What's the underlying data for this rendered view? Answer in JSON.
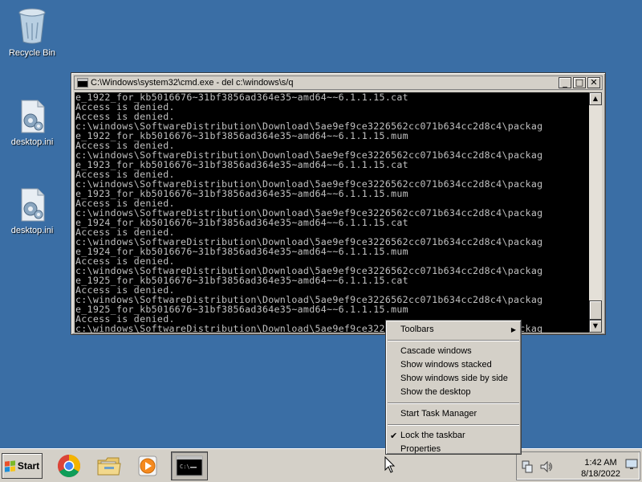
{
  "desktop": {
    "icons": [
      {
        "label": "Recycle Bin",
        "icon": "recycle-bin-icon"
      },
      {
        "label": "desktop.ini",
        "icon": "settings-file-icon"
      },
      {
        "label": "desktop.ini",
        "icon": "settings-file-icon"
      }
    ]
  },
  "cmd": {
    "title": "C:\\Windows\\system32\\cmd.exe - del  c:\\windows\\s/q",
    "minimize_glyph": "_",
    "maximize_glyph": "□",
    "close_glyph": "✕",
    "scroll_up_glyph": "▲",
    "scroll_down_glyph": "▼",
    "lines": [
      "e_1922_for_kb5016676~31bf3856ad364e35~amd64~~6.1.1.15.cat",
      "Access is denied.",
      "Access is denied.",
      "c:\\windows\\SoftwareDistribution\\Download\\5ae9ef9ce3226562cc071b634cc2d8c4\\packag",
      "e_1922_for_kb5016676~31bf3856ad364e35~amd64~~6.1.1.15.mum",
      "Access is denied.",
      "c:\\windows\\SoftwareDistribution\\Download\\5ae9ef9ce3226562cc071b634cc2d8c4\\packag",
      "e_1923_for_kb5016676~31bf3856ad364e35~amd64~~6.1.1.15.cat",
      "Access is denied.",
      "c:\\windows\\SoftwareDistribution\\Download\\5ae9ef9ce3226562cc071b634cc2d8c4\\packag",
      "e_1923_for_kb5016676~31bf3856ad364e35~amd64~~6.1.1.15.mum",
      "Access is denied.",
      "c:\\windows\\SoftwareDistribution\\Download\\5ae9ef9ce3226562cc071b634cc2d8c4\\packag",
      "e_1924_for_kb5016676~31bf3856ad364e35~amd64~~6.1.1.15.cat",
      "Access is denied.",
      "c:\\windows\\SoftwareDistribution\\Download\\5ae9ef9ce3226562cc071b634cc2d8c4\\packag",
      "e_1924_for_kb5016676~31bf3856ad364e35~amd64~~6.1.1.15.mum",
      "Access is denied.",
      "c:\\windows\\SoftwareDistribution\\Download\\5ae9ef9ce3226562cc071b634cc2d8c4\\packag",
      "e_1925_for_kb5016676~31bf3856ad364e35~amd64~~6.1.1.15.cat",
      "Access is denied.",
      "c:\\windows\\SoftwareDistribution\\Download\\5ae9ef9ce3226562cc071b634cc2d8c4\\packag",
      "e_1925_for_kb5016676~31bf3856ad364e35~amd64~~6.1.1.15.mum",
      "Access is denied.",
      "c:\\windows\\SoftwareDistribution\\Download\\5ae9ef9ce3226562cc071b634cc2d8c4\\packag"
    ]
  },
  "context_menu": {
    "toolbars": "Toolbars",
    "submenu_arrow": "▶",
    "cascade": "Cascade windows",
    "stacked": "Show windows stacked",
    "side_by_side": "Show windows side by side",
    "show_desktop": "Show the desktop",
    "task_manager": "Start Task Manager",
    "lock_taskbar": "Lock the taskbar",
    "lock_checked_glyph": "✔",
    "properties": "Properties"
  },
  "taskbar": {
    "start_label": "Start",
    "apps": [
      {
        "icon": "chrome-icon"
      },
      {
        "icon": "explorer-folder-icon"
      },
      {
        "icon": "media-player-icon"
      },
      {
        "icon": "cmd-icon"
      }
    ],
    "clock_time": "1:42 AM",
    "clock_date": "8/18/2022",
    "tray_icons": [
      "network-icon",
      "volume-icon",
      "action-center-icon"
    ]
  },
  "colors": {
    "desktop": "#3a6ea5",
    "console_bg": "#000000",
    "console_text": "#c0c0c0",
    "chrome_face": "#d4d0c8"
  }
}
